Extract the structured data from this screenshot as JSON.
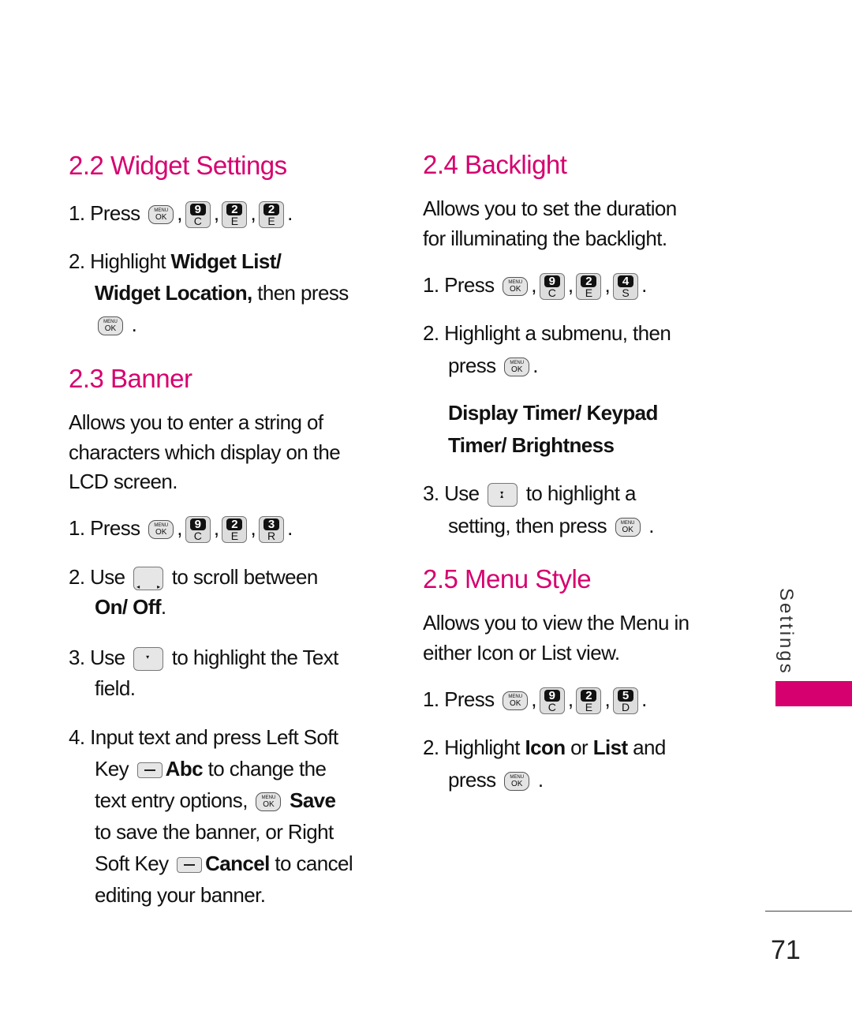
{
  "colors": {
    "accent": "#d6006e"
  },
  "left": [
    {
      "h": "2.2 Widget Settings"
    },
    {
      "segs": [
        {
          "t": "1. Press "
        },
        {
          "key": "ok"
        },
        {
          "t": ","
        },
        {
          "key": "num",
          "d": "9",
          "l": "C"
        },
        {
          "t": ","
        },
        {
          "key": "num",
          "d": "2",
          "l": "E"
        },
        {
          "t": ","
        },
        {
          "key": "num",
          "d": "2",
          "l": "E"
        },
        {
          "t": "."
        }
      ]
    },
    {
      "segs": [
        {
          "t": "2. Highlight "
        },
        {
          "b": "Widget List/"
        }
      ]
    },
    {
      "segs": [
        {
          "b": "Widget Location,"
        },
        {
          "t": " then press"
        }
      ]
    },
    {
      "segs": [
        {
          "key": "ok"
        },
        {
          "t": " ."
        }
      ]
    },
    {
      "h": "2.3 Banner"
    },
    {
      "segs": [
        {
          "t": "Allows you to enter a string of"
        }
      ]
    },
    {
      "segs": [
        {
          "t": "characters which display on the"
        }
      ]
    },
    {
      "segs": [
        {
          "t": "LCD screen."
        }
      ]
    },
    {
      "segs": [
        {
          "t": "1. Press "
        },
        {
          "key": "ok"
        },
        {
          "t": ","
        },
        {
          "key": "num",
          "d": "9",
          "l": "C"
        },
        {
          "t": ","
        },
        {
          "key": "num",
          "d": "2",
          "l": "E"
        },
        {
          "t": ","
        },
        {
          "key": "num",
          "d": "3",
          "l": "R"
        },
        {
          "t": "."
        }
      ]
    },
    {
      "segs": [
        {
          "t": "2. Use "
        },
        {
          "key": "nav-lr"
        },
        {
          "t": " to scroll between"
        }
      ]
    },
    {
      "segs": [
        {
          "b": "On/ Off"
        },
        {
          "t": "."
        }
      ]
    },
    {
      "segs": [
        {
          "t": "3. Use "
        },
        {
          "key": "nav-down"
        },
        {
          "t": " to highlight the Text"
        }
      ]
    },
    {
      "segs": [
        {
          "t": "field."
        }
      ]
    },
    {
      "segs": [
        {
          "t": "4. Input text and press Left Soft"
        }
      ]
    },
    {
      "segs": [
        {
          "t": "Key "
        },
        {
          "key": "soft"
        },
        {
          "b": "Abc"
        },
        {
          "t": " to change the"
        }
      ]
    },
    {
      "segs": [
        {
          "t": "text entry options, "
        },
        {
          "key": "ok"
        },
        {
          "b": " Save"
        }
      ]
    },
    {
      "segs": [
        {
          "t": "to save the banner, or Right"
        }
      ]
    },
    {
      "segs": [
        {
          "t": "Soft Key "
        },
        {
          "key": "soft"
        },
        {
          "b": "Cancel"
        },
        {
          "t": " to cancel"
        }
      ]
    },
    {
      "segs": [
        {
          "t": "editing your banner."
        }
      ]
    }
  ],
  "right": [
    {
      "h": "2.4 Backlight"
    },
    {
      "segs": [
        {
          "t": "Allows you to set the duration"
        }
      ]
    },
    {
      "segs": [
        {
          "t": "for illuminating the backlight."
        }
      ]
    },
    {
      "segs": [
        {
          "t": "1. Press "
        },
        {
          "key": "ok"
        },
        {
          "t": ","
        },
        {
          "key": "num",
          "d": "9",
          "l": "C"
        },
        {
          "t": ","
        },
        {
          "key": "num",
          "d": "2",
          "l": "E"
        },
        {
          "t": ","
        },
        {
          "key": "num",
          "d": "4",
          "l": "S"
        },
        {
          "t": "."
        }
      ]
    },
    {
      "segs": [
        {
          "t": "2. Highlight a submenu, then"
        }
      ]
    },
    {
      "segs": [
        {
          "t": "press "
        },
        {
          "key": "ok"
        },
        {
          "t": "."
        }
      ]
    },
    {
      "segs": [
        {
          "b": "Display Timer/ Keypad"
        }
      ]
    },
    {
      "segs": [
        {
          "b": "Timer/ Brightness"
        }
      ]
    },
    {
      "segs": [
        {
          "t": "3. Use "
        },
        {
          "key": "nav-ud"
        },
        {
          "t": " to highlight a"
        }
      ]
    },
    {
      "segs": [
        {
          "t": "setting, then press "
        },
        {
          "key": "ok"
        },
        {
          "t": " ."
        }
      ]
    },
    {
      "h": "2.5 Menu Style"
    },
    {
      "segs": [
        {
          "t": "Allows you to view the Menu in"
        }
      ]
    },
    {
      "segs": [
        {
          "t": "either Icon or List view."
        }
      ]
    },
    {
      "segs": [
        {
          "t": "1. Press "
        },
        {
          "key": "ok"
        },
        {
          "t": ","
        },
        {
          "key": "num",
          "d": "9",
          "l": "C"
        },
        {
          "t": ","
        },
        {
          "key": "num",
          "d": "2",
          "l": "E"
        },
        {
          "t": ","
        },
        {
          "key": "num",
          "d": "5",
          "l": "D"
        },
        {
          "t": "."
        }
      ]
    },
    {
      "segs": [
        {
          "t": "2. Highlight "
        },
        {
          "b": "Icon"
        },
        {
          "t": " or "
        },
        {
          "b": "List"
        },
        {
          "t": " and"
        }
      ]
    },
    {
      "segs": [
        {
          "t": "press "
        },
        {
          "key": "ok"
        },
        {
          "t": " ."
        }
      ]
    }
  ],
  "ok_key": {
    "top": "MENU",
    "bottom": "OK"
  },
  "side_tab": "Settings",
  "page_number": "71"
}
